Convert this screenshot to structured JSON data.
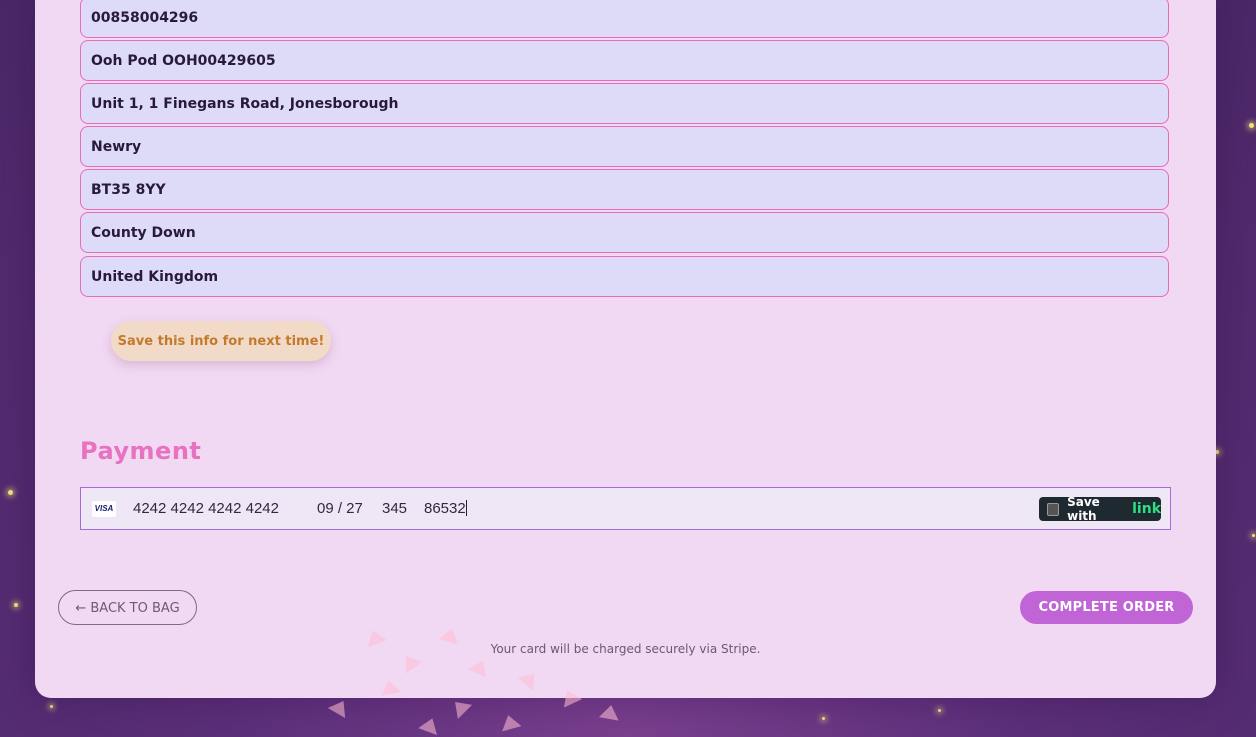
{
  "address": {
    "phone": "00858004296",
    "line1": "Ooh Pod OOH00429605",
    "line2": "Unit 1, 1 Finegans Road, Jonesborough",
    "city": "Newry",
    "postcode": "BT35 8YY",
    "county": "County Down",
    "country": "United Kingdom"
  },
  "save_info_label": "Save this info for next time!",
  "payment": {
    "title": "Payment",
    "card_brand": "VISA",
    "card_number": "4242 4242 4242 4242",
    "expiry": "09 / 27",
    "cvc": "345",
    "zip": "86532",
    "link_save_label": "Save with",
    "link_brand": "link"
  },
  "actions": {
    "back_label": "← BACK TO BAG",
    "complete_label": "COMPLETE ORDER"
  },
  "footer_note": "Your card will be charged securely via Stripe.",
  "colors": {
    "accent_pink": "#e872c0",
    "button_purple": "#c064d6",
    "field_bg": "#dddbf8",
    "link_green": "#2ce07f"
  }
}
